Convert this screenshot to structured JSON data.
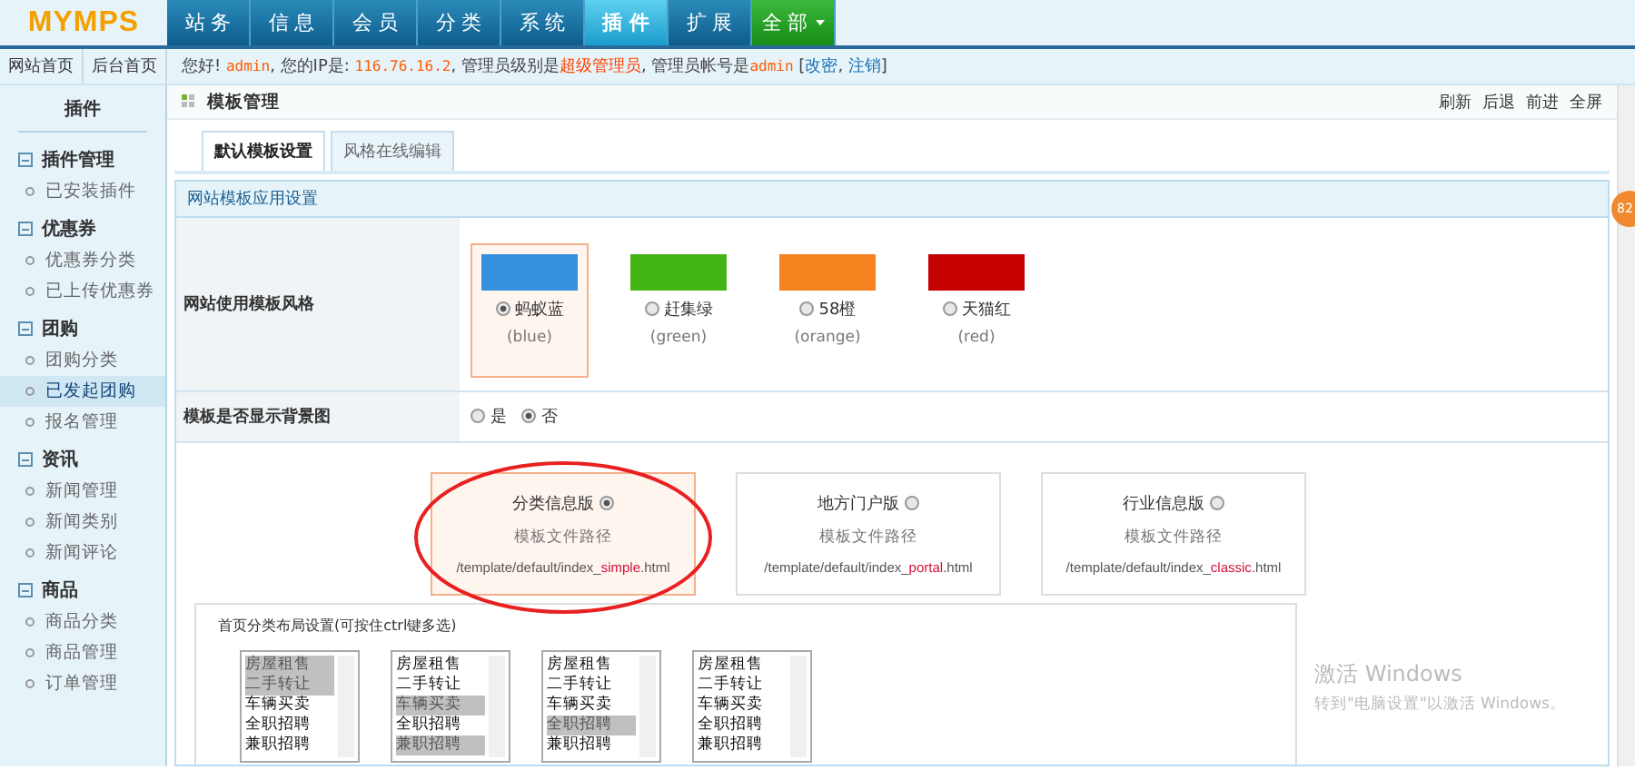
{
  "logo": "MYMPS",
  "nav": [
    {
      "label": "站 务",
      "selected": false,
      "kind": "tab"
    },
    {
      "label": "信 息",
      "selected": false,
      "kind": "tab"
    },
    {
      "label": "会 员",
      "selected": false,
      "kind": "tab"
    },
    {
      "label": "分 类",
      "selected": false,
      "kind": "tab"
    },
    {
      "label": "系 统",
      "selected": false,
      "kind": "tab"
    },
    {
      "label": "插 件",
      "selected": true,
      "kind": "tab"
    },
    {
      "label": "扩 展",
      "selected": false,
      "kind": "tab"
    },
    {
      "label": "全 部",
      "selected": false,
      "kind": "menu"
    }
  ],
  "quick_links": [
    "网站首页",
    "后台首页"
  ],
  "info": [
    {
      "kind": "text",
      "text": "您好! "
    },
    {
      "kind": "value",
      "text": "admin"
    },
    {
      "kind": "text",
      "text": ", 您的IP是: "
    },
    {
      "kind": "value",
      "text": "116.76.16.2"
    },
    {
      "kind": "text",
      "text": ", 管理员级别是"
    },
    {
      "kind": "level",
      "text": "超级管理员"
    },
    {
      "kind": "text",
      "text": ", 管理员帐号是"
    },
    {
      "kind": "value",
      "text": "admin"
    },
    {
      "kind": "text",
      "text": " ["
    },
    {
      "kind": "link",
      "text": "改密"
    },
    {
      "kind": "text",
      "text": ", "
    },
    {
      "kind": "link",
      "text": "注销"
    },
    {
      "kind": "text",
      "text": "]"
    }
  ],
  "sidebar": {
    "title": "插件",
    "groups": [
      {
        "label": "插件管理",
        "expanded": true,
        "children": [
          {
            "label": "已安装插件",
            "selected": false
          }
        ]
      },
      {
        "label": "优惠券",
        "expanded": true,
        "children": [
          {
            "label": "优惠券分类",
            "selected": false
          },
          {
            "label": "已上传优惠券",
            "selected": false
          }
        ]
      },
      {
        "label": "团购",
        "expanded": true,
        "children": [
          {
            "label": "团购分类",
            "selected": false
          },
          {
            "label": "已发起团购",
            "selected": true
          },
          {
            "label": "报名管理",
            "selected": false
          }
        ]
      },
      {
        "label": "资讯",
        "expanded": true,
        "children": [
          {
            "label": "新闻管理",
            "selected": false
          },
          {
            "label": "新闻类别",
            "selected": false
          },
          {
            "label": "新闻评论",
            "selected": false
          }
        ]
      },
      {
        "label": "商品",
        "expanded": true,
        "children": [
          {
            "label": "商品分类",
            "selected": false
          },
          {
            "label": "商品管理",
            "selected": false
          },
          {
            "label": "订单管理",
            "selected": false
          }
        ]
      }
    ]
  },
  "page_title": "模板管理",
  "toolbar": [
    "刷新",
    "后退",
    "前进",
    "全屏"
  ],
  "tabs": [
    {
      "label": "默认模板设置",
      "selected": true
    },
    {
      "label": "风格在线编辑",
      "selected": false
    }
  ],
  "panel_title": "网站模板应用设置",
  "style_row": {
    "label": "网站使用模板风格",
    "options": [
      {
        "name": "蚂蚁蓝",
        "code": "(blue)",
        "color": "#3590e0",
        "selected": true
      },
      {
        "name": "赶集绿",
        "code": "(green)",
        "color": "#42b515",
        "selected": false
      },
      {
        "name": "58橙",
        "code": "(orange)",
        "color": "#f5821f",
        "selected": false
      },
      {
        "name": "天猫红",
        "code": "(red)",
        "color": "#c40000",
        "selected": false
      }
    ]
  },
  "background_row": {
    "label": "模板是否显示背景图",
    "options": [
      {
        "label": "是",
        "selected": false
      },
      {
        "label": "否",
        "selected": true
      }
    ]
  },
  "templates": [
    {
      "name": "分类信息版",
      "selected": true,
      "caption": "模板文件路径",
      "path_start": "/template/default/index_",
      "path_key": "simple",
      "path_end": ".html"
    },
    {
      "name": "地方门户版",
      "selected": false,
      "caption": "模板文件路径",
      "path_start": "/template/default/index_",
      "path_key": "portal",
      "path_end": ".html"
    },
    {
      "name": "行业信息版",
      "selected": false,
      "caption": "模板文件路径",
      "path_start": "/template/default/index_",
      "path_key": "classic",
      "path_end": ".html"
    }
  ],
  "layout": {
    "title": "首页分类布局设置(可按住ctrl键多选)",
    "lists": [
      [
        {
          "label": "房屋租售",
          "selected": true
        },
        {
          "label": "二手转让",
          "selected": true
        },
        {
          "label": "车辆买卖",
          "selected": false
        },
        {
          "label": "全职招聘",
          "selected": false
        },
        {
          "label": "兼职招聘",
          "selected": false
        }
      ],
      [
        {
          "label": "房屋租售",
          "selected": false
        },
        {
          "label": "二手转让",
          "selected": false
        },
        {
          "label": "车辆买卖",
          "selected": true
        },
        {
          "label": "全职招聘",
          "selected": false
        },
        {
          "label": "兼职招聘",
          "selected": true
        }
      ],
      [
        {
          "label": "房屋租售",
          "selected": false
        },
        {
          "label": "二手转让",
          "selected": false
        },
        {
          "label": "车辆买卖",
          "selected": false
        },
        {
          "label": "全职招聘",
          "selected": true
        },
        {
          "label": "兼职招聘",
          "selected": false
        }
      ],
      [
        {
          "label": "房屋租售",
          "selected": false
        },
        {
          "label": "二手转让",
          "selected": false
        },
        {
          "label": "车辆买卖",
          "selected": false
        },
        {
          "label": "全职招聘",
          "selected": false
        },
        {
          "label": "兼职招聘",
          "selected": false
        }
      ]
    ]
  },
  "side_badge": "82",
  "activation": {
    "title": "激活 Windows",
    "hint": "转到\"电脑设置\"以激活 Windows。"
  }
}
